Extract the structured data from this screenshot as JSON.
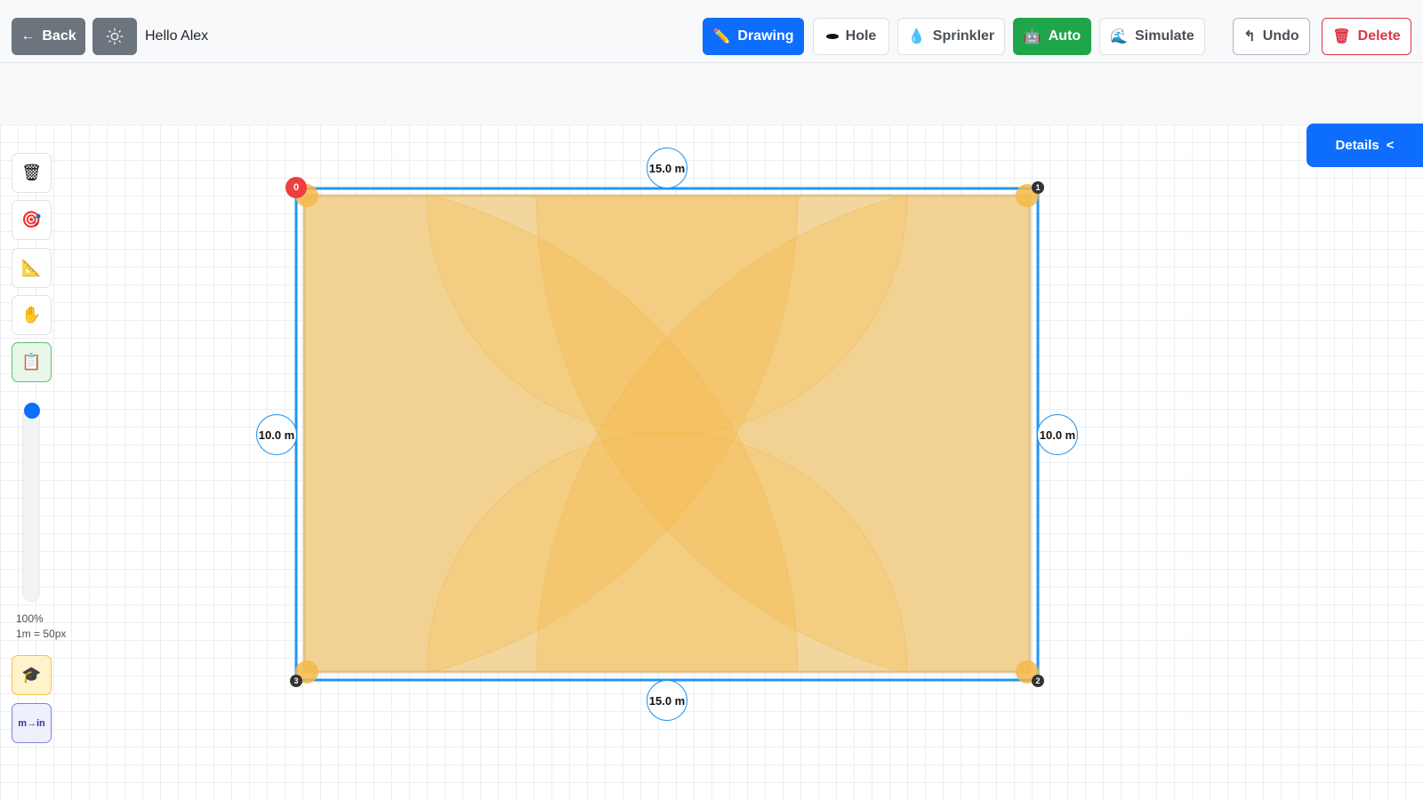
{
  "header": {
    "back_label": "Back",
    "greeting": "Hello Alex",
    "modes": {
      "drawing": "Drawing",
      "hole": "Hole",
      "sprinkler": "Sprinkler",
      "auto": "Auto",
      "simulate": "Simulate"
    },
    "undo_label": "Undo",
    "delete_label": "Delete"
  },
  "details_label": "Details",
  "sidebar": {
    "tools": [
      "trash-icon",
      "target-icon",
      "ruler-triangle-icon",
      "hand-icon",
      "clipboard-icon"
    ],
    "zoom_percent": "100%",
    "scale_text": "1m = 50px",
    "units_toggle": "m→in"
  },
  "area": {
    "top_length": "15.0 m",
    "bottom_length": "15.0 m",
    "left_length": "10.0 m",
    "right_length": "10.0 m",
    "corner_labels": [
      "0",
      "1",
      "2",
      "3"
    ]
  },
  "colors": {
    "primary": "#0d6efd",
    "success": "#1fa64a",
    "danger": "#dc3545",
    "spray": "#f5b94a",
    "outline": "#2196f3"
  }
}
